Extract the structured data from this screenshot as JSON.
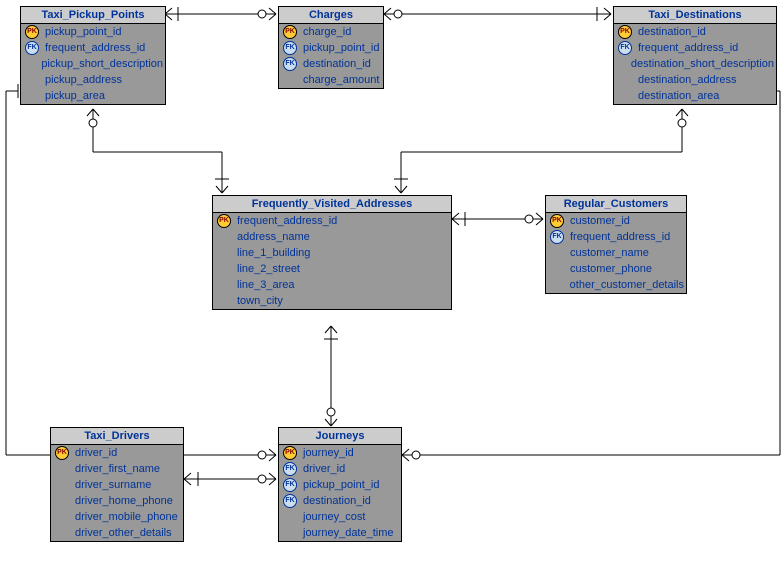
{
  "entities": {
    "pickup": {
      "title": "Taxi_Pickup_Points",
      "cols": [
        {
          "key": "pk",
          "name": "pickup_point_id"
        },
        {
          "key": "fk",
          "name": "frequent_address_id"
        },
        {
          "key": "",
          "name": "pickup_short_description"
        },
        {
          "key": "",
          "name": "pickup_address"
        },
        {
          "key": "",
          "name": "pickup_area"
        }
      ]
    },
    "charges": {
      "title": "Charges",
      "cols": [
        {
          "key": "pk",
          "name": "charge_id"
        },
        {
          "key": "fk",
          "name": "pickup_point_id"
        },
        {
          "key": "fk",
          "name": "destination_id"
        },
        {
          "key": "",
          "name": "charge_amount"
        }
      ]
    },
    "dest": {
      "title": "Taxi_Destinations",
      "cols": [
        {
          "key": "pk",
          "name": "destination_id"
        },
        {
          "key": "fk",
          "name": "frequent_address_id"
        },
        {
          "key": "",
          "name": "destination_short_description"
        },
        {
          "key": "",
          "name": "destination_address"
        },
        {
          "key": "",
          "name": "destination_area"
        }
      ]
    },
    "freq": {
      "title": "Frequently_Visited_Addresses",
      "cols": [
        {
          "key": "pk",
          "name": "frequent_address_id"
        },
        {
          "key": "",
          "name": "address_name"
        },
        {
          "key": "",
          "name": "line_1_building"
        },
        {
          "key": "",
          "name": "line_2_street"
        },
        {
          "key": "",
          "name": "line_3_area"
        },
        {
          "key": "",
          "name": "town_city"
        }
      ]
    },
    "cust": {
      "title": "Regular_Customers",
      "cols": [
        {
          "key": "pk",
          "name": "customer_id"
        },
        {
          "key": "fk",
          "name": "frequent_address_id"
        },
        {
          "key": "",
          "name": "customer_name"
        },
        {
          "key": "",
          "name": "customer_phone"
        },
        {
          "key": "",
          "name": "other_customer_details"
        }
      ]
    },
    "drivers": {
      "title": "Taxi_Drivers",
      "cols": [
        {
          "key": "pk",
          "name": "driver_id"
        },
        {
          "key": "",
          "name": "driver_first_name"
        },
        {
          "key": "",
          "name": "driver_surname"
        },
        {
          "key": "",
          "name": "driver_home_phone"
        },
        {
          "key": "",
          "name": "driver_mobile_phone"
        },
        {
          "key": "",
          "name": "driver_other_details"
        }
      ]
    },
    "journeys": {
      "title": "Journeys",
      "cols": [
        {
          "key": "pk",
          "name": "journey_id"
        },
        {
          "key": "fk",
          "name": "driver_id"
        },
        {
          "key": "fk",
          "name": "pickup_point_id"
        },
        {
          "key": "fk",
          "name": "destination_id"
        },
        {
          "key": "",
          "name": "journey_cost"
        },
        {
          "key": "",
          "name": "journey_date_time"
        }
      ]
    }
  }
}
